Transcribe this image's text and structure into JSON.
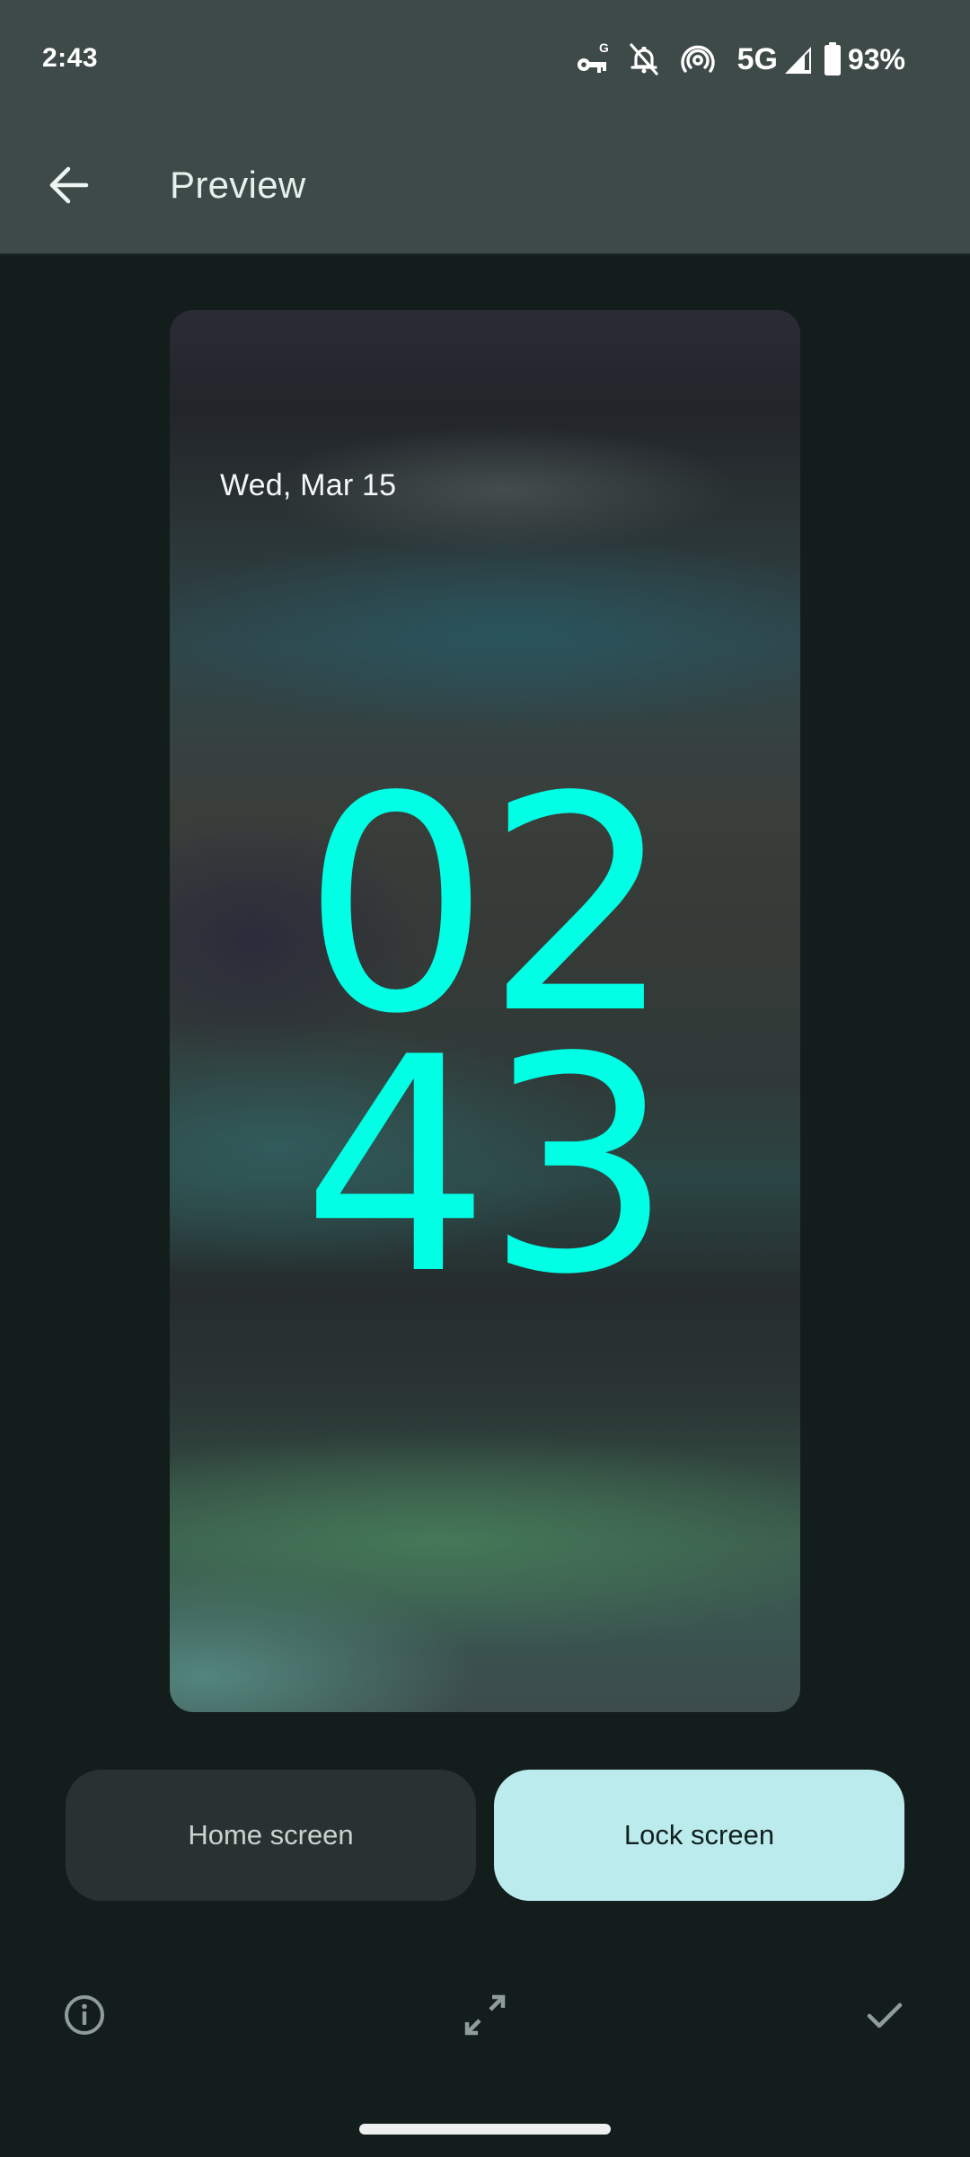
{
  "status_bar": {
    "time": "2:43",
    "icons": [
      "vpn-key-icon",
      "notifications-off-icon",
      "hotspot-icon",
      "signal-icon",
      "battery-icon"
    ],
    "network_type": "5G",
    "battery_percent": "93%"
  },
  "app_bar": {
    "back_icon": "arrow-back-icon",
    "title": "Preview"
  },
  "preview": {
    "screen": "Lock screen",
    "date": "Wed, Mar 15",
    "clock_hours": "02",
    "clock_minutes": "43",
    "clock_color": "#00ffe4"
  },
  "tabs": [
    {
      "label": "Home screen",
      "selected": false
    },
    {
      "label": "Lock screen",
      "selected": true
    }
  ],
  "actions": [
    {
      "name": "info",
      "icon": "info-icon"
    },
    {
      "name": "fullscreen",
      "icon": "expand-icon"
    },
    {
      "name": "apply",
      "icon": "check-icon"
    }
  ],
  "colors": {
    "top_bar": "#3d4a47",
    "background": "#131e1c",
    "tab_unselected": "#283331",
    "tab_selected": "#bcebee",
    "icon_tint": "#8f9c99"
  }
}
